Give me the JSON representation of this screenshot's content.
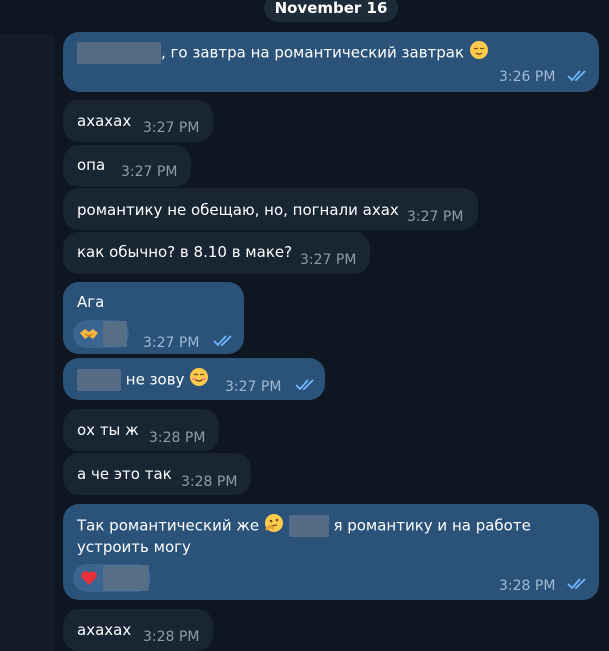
{
  "date_pill": "November 16",
  "messages": {
    "m1": {
      "text": ", го завтра на романтический завтрак",
      "time": "3:26 PM",
      "emoji": "relieved-face-icon"
    },
    "m2": {
      "text": "ахахах",
      "time": "3:27 PM"
    },
    "m3": {
      "text": "опа",
      "time": "3:27 PM"
    },
    "m4": {
      "text": "романтику не обещаю, но, погнали ахах",
      "time": "3:27 PM"
    },
    "m5": {
      "text": "как обычно? в 8.10 в маке?",
      "time": "3:27 PM"
    },
    "m6": {
      "text": "Ага",
      "time": "3:27 PM",
      "reaction_emoji": "handshake-icon"
    },
    "m7": {
      "text": "не зову",
      "time": "3:27 PM",
      "emoji": "smiling-face-icon"
    },
    "m8": {
      "text": "ох ты ж",
      "time": "3:28 PM"
    },
    "m9": {
      "text": "а че это так",
      "time": "3:28 PM"
    },
    "m10": {
      "text_a": "Так романтический же",
      "text_b": "я романтику и на работе",
      "text_c": "устроить могу",
      "time": "3:28 PM",
      "emoji": "thinking-face-icon",
      "reaction_emoji": "red-heart-icon"
    },
    "m11": {
      "text": "ахахах",
      "time": "3:28 PM"
    }
  },
  "colors": {
    "background": "#0e1621",
    "incoming_bubble": "#182533",
    "outgoing_bubble": "#2b5278",
    "read_ticks": "#6fb7ff"
  }
}
